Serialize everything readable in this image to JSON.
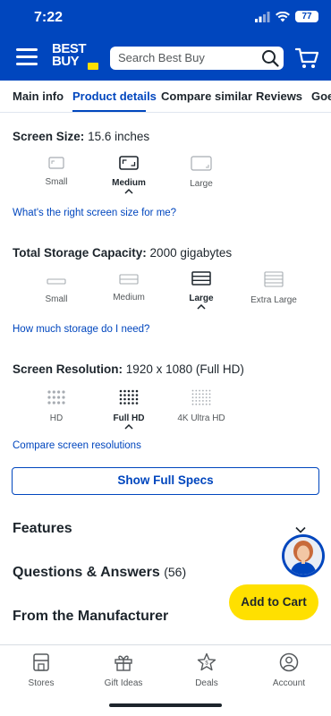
{
  "status": {
    "time": "7:22",
    "battery": "77"
  },
  "header": {
    "search_placeholder": "Search Best Buy",
    "logo": "BEST BUY"
  },
  "tabs": [
    "Main info",
    "Product details",
    "Compare similar",
    "Reviews",
    "Goe"
  ],
  "active_tab": "Product details",
  "screen_size": {
    "label": "Screen Size:",
    "value": "15.6 inches",
    "options": [
      "Small",
      "Medium",
      "Large"
    ],
    "selected": "Medium",
    "link": "What's the right screen size for me?"
  },
  "storage": {
    "label": "Total Storage Capacity:",
    "value": "2000 gigabytes",
    "options": [
      "Small",
      "Medium",
      "Large",
      "Extra Large"
    ],
    "selected": "Large",
    "link": "How much storage do I need?"
  },
  "resolution": {
    "label": "Screen Resolution:",
    "value": "1920 x 1080 (Full HD)",
    "options": [
      "HD",
      "Full HD",
      "4K Ultra HD"
    ],
    "selected": "Full HD",
    "link": "Compare screen resolutions"
  },
  "full_specs_button": "Show Full Specs",
  "sections": {
    "features": "Features",
    "qa": "Questions & Answers",
    "qa_count": "(56)",
    "manufacturer": "From the Manufacturer"
  },
  "add_to_cart": "Add to Cart",
  "bottom_nav": [
    "Stores",
    "Gift Ideas",
    "Deals",
    "Account"
  ],
  "colors": {
    "brand_blue": "#0046be",
    "brand_yellow": "#ffe000",
    "text": "#1d252c"
  }
}
